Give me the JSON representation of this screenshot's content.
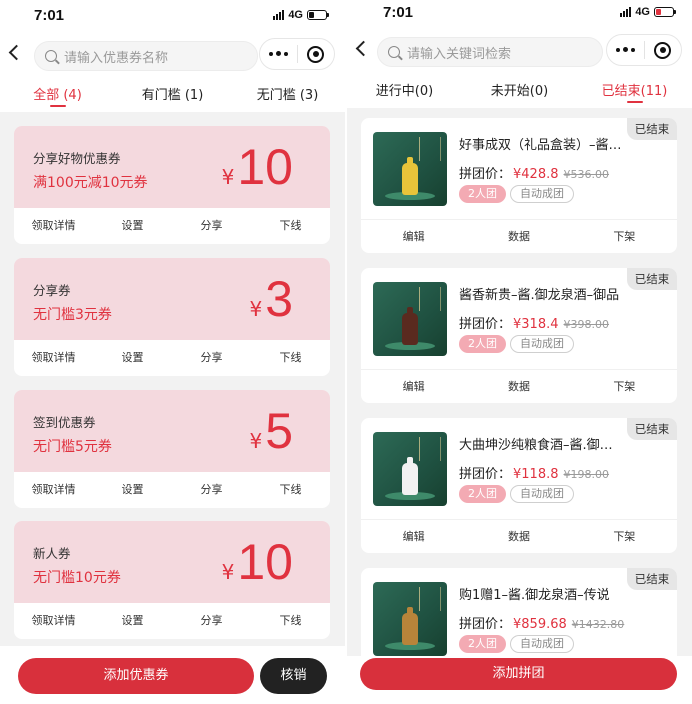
{
  "coupons_screen": {
    "status": {
      "time": "7:01",
      "network": "4G"
    },
    "search": {
      "placeholder": "请输入优惠券名称"
    },
    "tabs": [
      {
        "label": "全部 (4)",
        "active": true
      },
      {
        "label": "有门槛 (1)",
        "active": false
      },
      {
        "label": "无门槛 (3)",
        "active": false
      }
    ],
    "coupons": [
      {
        "name": "分享好物优惠券",
        "desc": "满100元减10元券",
        "currency": "¥",
        "value": "10"
      },
      {
        "name": "分享券",
        "desc": "无门槛3元券",
        "currency": "¥",
        "value": "3"
      },
      {
        "name": "签到优惠券",
        "desc": "无门槛5元券",
        "currency": "¥",
        "value": "5"
      },
      {
        "name": "新人券",
        "desc": "无门槛10元券",
        "currency": "¥",
        "value": "10"
      }
    ],
    "coupon_actions": [
      "领取详情",
      "设置",
      "分享",
      "下线"
    ],
    "bottom": {
      "add_label": "添加优惠券",
      "verify_label": "核销"
    }
  },
  "groupbuy_screen": {
    "status": {
      "time": "7:01",
      "network": "4G"
    },
    "search": {
      "placeholder": "请输入关键词检索"
    },
    "tabs": [
      {
        "label": "进行中(0)",
        "active": false
      },
      {
        "label": "未开始(0)",
        "active": false
      },
      {
        "label": "已结束(11)",
        "active": true
      }
    ],
    "items": [
      {
        "badge": "已结束",
        "title": "好事成双（礼品盒装）–酱香型白酒",
        "price_label": "拼团价：",
        "price": "¥428.8",
        "original_price": "¥536.00",
        "group_tag": "2人团",
        "auto_tag": "自动成团",
        "bottle_color": "#e8c43a"
      },
      {
        "badge": "已结束",
        "title": "酱香新贵–酱.御龙泉酒–御品",
        "price_label": "拼团价：",
        "price": "¥318.4",
        "original_price": "¥398.00",
        "group_tag": "2人团",
        "auto_tag": "自动成团",
        "bottle_color": "#5a2a1f"
      },
      {
        "badge": "已结束",
        "title": "大曲坤沙纯粮食酒–酱.御龙泉酒",
        "price_label": "拼团价：",
        "price": "¥118.8",
        "original_price": "¥198.00",
        "group_tag": "2人团",
        "auto_tag": "自动成团",
        "bottle_color": "#f2f2f2"
      },
      {
        "badge": "已结束",
        "title": "购1赠1–酱.御龙泉酒–传说",
        "price_label": "拼团价：",
        "price": "¥859.68",
        "original_price": "¥1432.80",
        "group_tag": "2人团",
        "auto_tag": "自动成团",
        "bottle_color": "#b8843a"
      }
    ],
    "item_actions": [
      "编辑",
      "数据",
      "下架"
    ],
    "bottom": {
      "add_label": "添加拼团"
    }
  },
  "colors": {
    "accent": "#e0323f",
    "coupon_bg": "#f4d9de",
    "dark_button": "#222222"
  }
}
